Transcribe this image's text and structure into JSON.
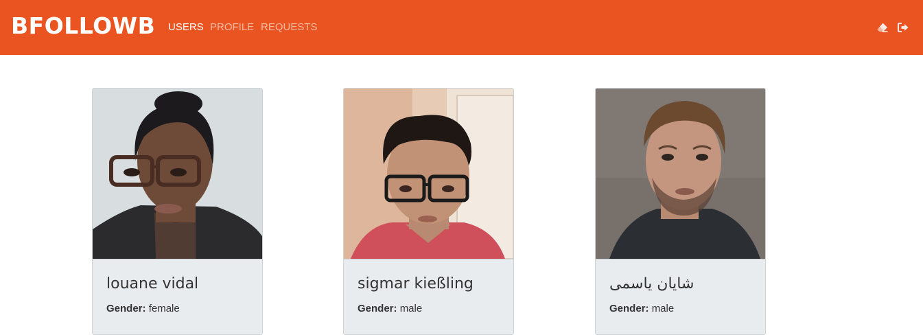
{
  "navbar": {
    "brand": "BFOLLOWB",
    "links": [
      {
        "label": "USERS",
        "active": true
      },
      {
        "label": "PROFILE",
        "active": false
      },
      {
        "label": "REQUESTS",
        "active": false
      }
    ],
    "icons": [
      "eraser-icon",
      "sign-out-icon"
    ],
    "color": "#e95420"
  },
  "users": [
    {
      "name": "louane vidal",
      "gender_label": "Gender:",
      "gender": "female"
    },
    {
      "name": "sigmar kießling",
      "gender_label": "Gender:",
      "gender": "male"
    },
    {
      "name": "شایان یاسمی",
      "gender_label": "Gender:",
      "gender": "male"
    }
  ]
}
